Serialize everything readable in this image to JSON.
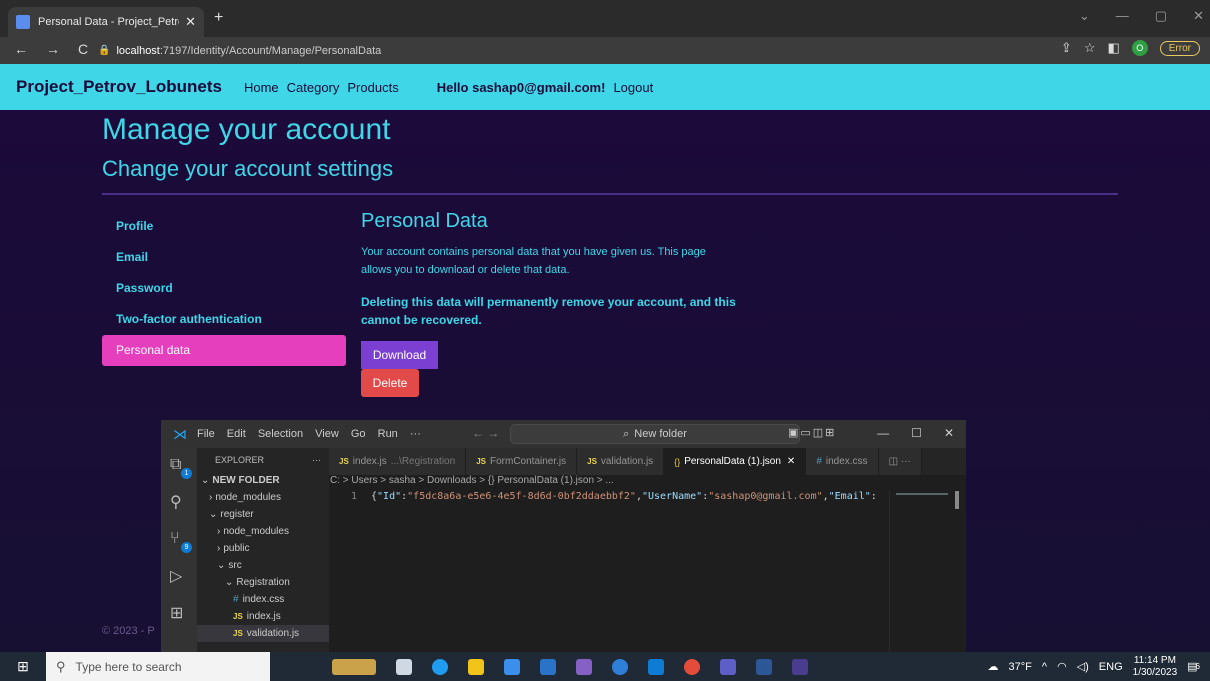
{
  "browser": {
    "tab_title": "Personal Data - Project_Petrov_Lc",
    "url_host": "localhost",
    "url_path": ":7197/Identity/Account/Manage/PersonalData",
    "profile_initial": "O",
    "error_label": "Error"
  },
  "site": {
    "brand": "Project_Petrov_Lobunets",
    "nav": [
      "Home",
      "Category",
      "Products"
    ],
    "hello": "Hello sashap0@gmail.com!",
    "logout": "Logout"
  },
  "page": {
    "title": "Manage your account",
    "subtitle": "Change your account settings",
    "sidenav": [
      "Profile",
      "Email",
      "Password",
      "Two-factor authentication",
      "Personal data"
    ],
    "active_index": 4,
    "section_title": "Personal Data",
    "info": "Your account contains personal data that you have given us. This page allows you to download or delete that data.",
    "warning": "Deleting this data will permanently remove your account, and this cannot be recovered.",
    "download_label": "Download",
    "delete_label": "Delete",
    "footer": "© 2023 - P"
  },
  "vscode": {
    "menu": [
      "File",
      "Edit",
      "Selection",
      "View",
      "Go",
      "Run",
      "···"
    ],
    "search_placeholder": "New folder",
    "explorer_label": "EXPLORER",
    "explorer_more": "···",
    "tree": [
      {
        "label": "NEW FOLDER",
        "depth": 0,
        "kind": "folder-open",
        "bold": true
      },
      {
        "label": "node_modules",
        "depth": 1,
        "kind": "folder"
      },
      {
        "label": "register",
        "depth": 1,
        "kind": "folder-open"
      },
      {
        "label": "node_modules",
        "depth": 2,
        "kind": "folder"
      },
      {
        "label": "public",
        "depth": 2,
        "kind": "folder"
      },
      {
        "label": "src",
        "depth": 2,
        "kind": "folder-open"
      },
      {
        "label": "Registration",
        "depth": 3,
        "kind": "folder-open"
      },
      {
        "label": "index.css",
        "depth": 4,
        "kind": "css"
      },
      {
        "label": "index.js",
        "depth": 4,
        "kind": "js"
      },
      {
        "label": "validation.js",
        "depth": 4,
        "kind": "js",
        "selected": true
      }
    ],
    "tabs": [
      {
        "label": "index.js",
        "hint": "...\\Registration",
        "kind": "js"
      },
      {
        "label": "FormContainer.js",
        "kind": "js"
      },
      {
        "label": "validation.js",
        "kind": "js"
      },
      {
        "label": "PersonalData (1).json",
        "kind": "json",
        "active": true
      },
      {
        "label": "index.css",
        "kind": "css"
      }
    ],
    "breadcrumbs": "C: > Users > sasha > Downloads > {} PersonalData (1).json > ...",
    "line_number": "1",
    "code": [
      {
        "t": "pun",
        "v": "{"
      },
      {
        "t": "key",
        "v": "\"Id\""
      },
      {
        "t": "pun",
        "v": ":"
      },
      {
        "t": "str",
        "v": "\"f5dc8a6a-e5e6-4e5f-8d6d-0bf2ddaebbf2\""
      },
      {
        "t": "pun",
        "v": ","
      },
      {
        "t": "key",
        "v": "\"UserName\""
      },
      {
        "t": "pun",
        "v": ":"
      },
      {
        "t": "str",
        "v": "\"sashap0@gmail.com\""
      },
      {
        "t": "pun",
        "v": ","
      },
      {
        "t": "key",
        "v": "\"Email\""
      },
      {
        "t": "pun",
        "v": ":"
      }
    ],
    "badges": {
      "explorer": "1",
      "scm": "9"
    }
  },
  "taskbar": {
    "search_placeholder": "Type here to search",
    "weather": "37°F",
    "lang": "ENG",
    "time": "11:14 PM",
    "date": "1/30/2023",
    "notif_count": "6"
  }
}
